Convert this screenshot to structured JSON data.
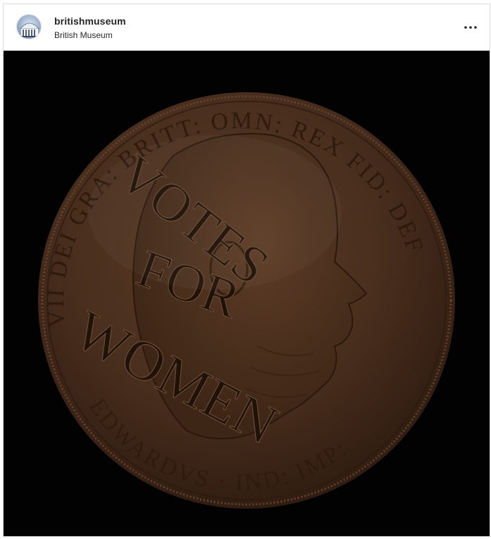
{
  "post": {
    "username": "britishmuseum",
    "location": "British Museum",
    "avatar_icon": "british-museum-logo-icon",
    "more_icon": "more-options-icon"
  },
  "image": {
    "subject": "copper penny",
    "inscription": "EDWARDVS VII DEI GRA: BRITT: OMN: REX FID: DEF: IND: IMP:",
    "stamp": [
      "VOTES",
      "FOR",
      "WOMEN"
    ]
  },
  "colors": {
    "background": "#020202",
    "coin": "#4a2f1e",
    "border": "#dbdbdb"
  }
}
